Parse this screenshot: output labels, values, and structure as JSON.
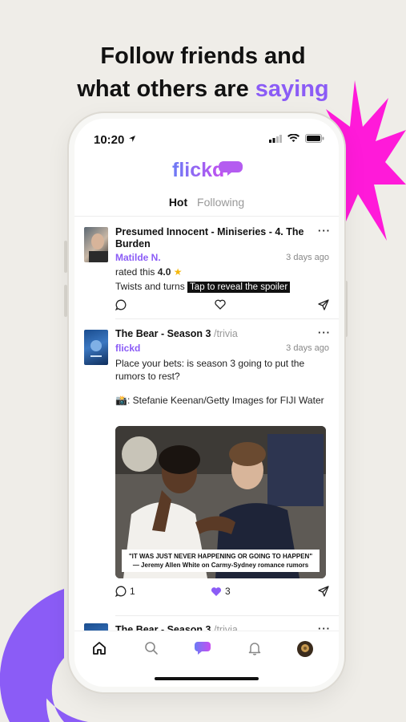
{
  "headline": {
    "line1": "Follow friends and",
    "line2_prefix": "what others are ",
    "line2_accent": "saying"
  },
  "status": {
    "time": "10:20"
  },
  "app": {
    "logo": "flickd"
  },
  "tabs": [
    {
      "label": "Hot",
      "active": true
    },
    {
      "label": "Following",
      "active": false
    }
  ],
  "posts": [
    {
      "title": "Presumed Innocent - Miniseries - 4. The Burden",
      "author": "Matilde N.",
      "date": "3 days ago",
      "rated_prefix": "rated this ",
      "rating": "4.0",
      "text": "Twists and turns ",
      "spoiler": "Tap to reveal the spoiler"
    },
    {
      "title": "The Bear - Season 3",
      "title_suffix": " /trivia",
      "author": "flickd",
      "date": "3 days ago",
      "text": "Place your bets: is season 3 going to put the rumors to rest?",
      "credit": "📸: Stefanie Keenan/Getty Images for FIJI Water",
      "image_caption_quote": "\"IT WAS JUST NEVER HAPPENING OR GOING TO HAPPEN\"",
      "image_caption_attr": "— Jeremy Allen White on Carmy-Sydney romance rumors",
      "comments": "1",
      "likes": "3"
    },
    {
      "title": "The Bear - Season 3",
      "title_suffix": " /trivia"
    }
  ],
  "colors": {
    "accent": "#8b5cf6",
    "star": "#f5b70a",
    "starburst": "#ff1ad9",
    "arc": "#8b5cf6"
  },
  "icons": [
    "location-arrow-icon",
    "signal-icon",
    "wifi-icon",
    "battery-icon",
    "comment-icon",
    "heart-icon",
    "send-icon",
    "home-icon",
    "search-icon",
    "chat-bubble-icon",
    "bell-icon",
    "avatar"
  ]
}
